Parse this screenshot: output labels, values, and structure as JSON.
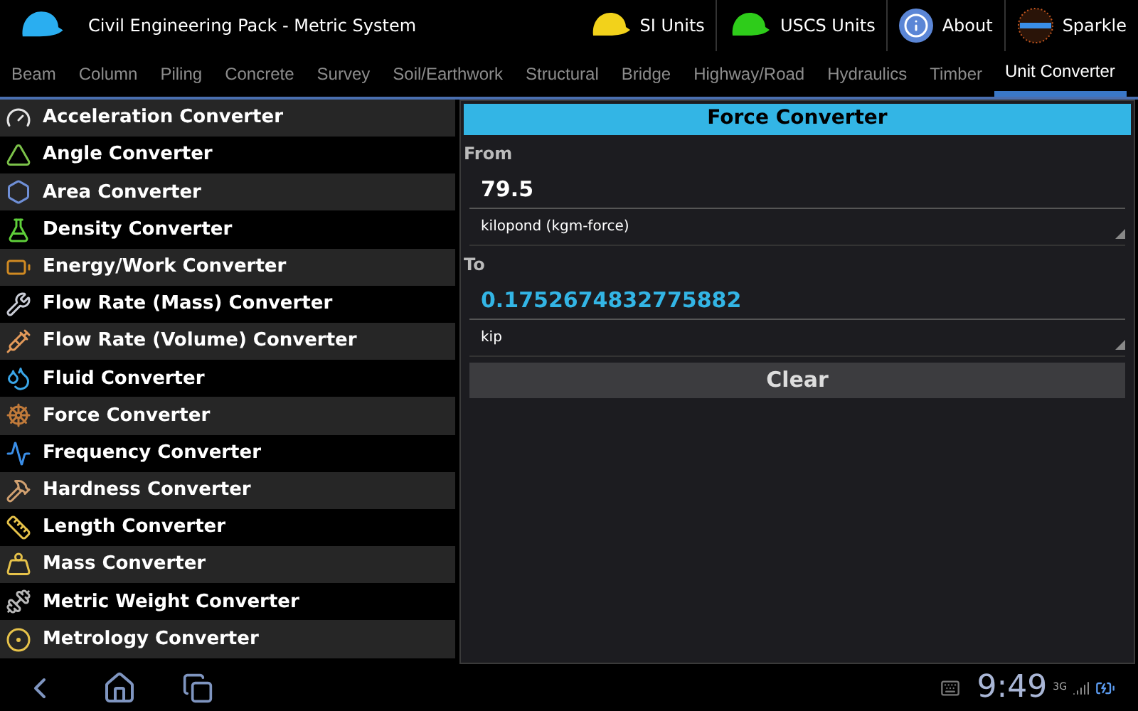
{
  "app_bar": {
    "title": "Civil Engineering Pack - Metric System",
    "actions": [
      {
        "label": "SI Units",
        "kind": "helmet",
        "color": "#f2d21b"
      },
      {
        "label": "USCS Units",
        "kind": "helmet",
        "color": "#2ecc1a"
      },
      {
        "label": "About",
        "kind": "info"
      },
      {
        "label": "Sparkle",
        "kind": "logo"
      }
    ]
  },
  "tabs": [
    {
      "label": "Beam",
      "selected": false
    },
    {
      "label": "Column",
      "selected": false
    },
    {
      "label": "Piling",
      "selected": false
    },
    {
      "label": "Concrete",
      "selected": false
    },
    {
      "label": "Survey",
      "selected": false
    },
    {
      "label": "Soil/Earthwork",
      "selected": false
    },
    {
      "label": "Structural",
      "selected": false
    },
    {
      "label": "Bridge",
      "selected": false
    },
    {
      "label": "Highway/Road",
      "selected": false
    },
    {
      "label": "Hydraulics",
      "selected": false
    },
    {
      "label": "Timber",
      "selected": false
    },
    {
      "label": "Unit Converter",
      "selected": true
    }
  ],
  "converters": [
    "Acceleration Converter",
    "Angle Converter",
    "Area Converter",
    "Density Converter",
    "Energy/Work Converter",
    "Flow Rate (Mass) Converter",
    "Flow Rate (Volume) Converter",
    "Fluid Converter",
    "Force Converter",
    "Frequency Converter",
    "Hardness Converter",
    "Length Converter",
    "Mass Converter",
    "Metric Weight Converter",
    "Metrology Converter"
  ],
  "panel": {
    "title": "Force Converter",
    "from_label": "From",
    "from_value": "79.5",
    "from_unit": "kilopond (kgm-force)",
    "to_label": "To",
    "to_value": "0.1752674832775882",
    "to_unit": "kip",
    "clear_button": "Clear"
  },
  "status_bar": {
    "time": "9:49",
    "network": "3G"
  }
}
